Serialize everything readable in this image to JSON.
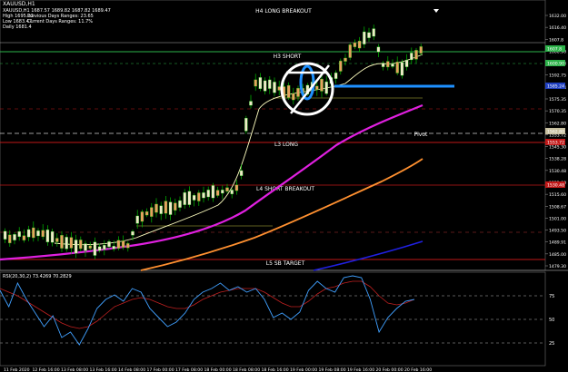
{
  "window": {
    "title": "XAUUSD,H1"
  },
  "ohlc_header": "XAUUSD,H1  1687.57 1689.82 1687.82 1689.47",
  "info_lines": [
    {
      "left": "High 1695.12",
      "right": "Previous Days Ranges: 23.65"
    },
    {
      "left": "Low 1683.47",
      "right": "Current Days Ranges: 11.7%"
    },
    {
      "left": "Daily 1681.4",
      "right": ""
    }
  ],
  "levels": {
    "h4": "H4 LONG BREAKOUT",
    "h3": "H3 SHORT",
    "l3": "L3 LONG",
    "l4": "L4 SHORT BREAKOUT",
    "l5": "L5 SB TARGET",
    "pivot": "Pivot"
  },
  "price_scale": [
    "1632.00",
    "1616.40",
    "1607.8",
    "1600.90",
    "1600.73",
    "1592.75",
    "1585.24",
    "1575.35",
    "1570.35",
    "1562.80",
    "1553.72",
    "1545.30",
    "1538.28",
    "1530.48",
    "1522.80",
    "1515.60",
    "1508.67",
    "1501.00",
    "1493.50",
    "1489.91",
    "1485.00",
    "1479.30"
  ],
  "price_scale_tags": [
    {
      "label": "1607.8",
      "color": "#2db34a"
    },
    {
      "label": "1600.90",
      "color": "#2db34a"
    },
    {
      "label": "1585.24",
      "color": "#2040c0"
    },
    {
      "label": "1562.80",
      "color": "#c8c0a0"
    },
    {
      "label": "1553.72",
      "color": "#c01818"
    },
    {
      "label": "1530.48",
      "color": "#c01818"
    }
  ],
  "indicator": {
    "label": "RSI(20,30,2) 73.4269 70.2829",
    "scale": [
      "75",
      "50",
      "25"
    ]
  },
  "time_axis": [
    "11 Feb 2020",
    "12 Feb 16:00",
    "13 Feb 08:00",
    "13 Feb 16:00",
    "14 Feb 08:00",
    "17 Feb 00:00",
    "17 Feb 08:00",
    "18 Feb 00:00",
    "18 Feb 08:00",
    "18 Feb 16:00",
    "19 Feb 00:00",
    "19 Feb 08:00",
    "19 Feb 16:00",
    "20 Feb 00:00",
    "20 Feb 16:00"
  ],
  "colors": {
    "background": "#000000",
    "bull_candle": "#f0e8c8",
    "bear_candle": "#e8a060",
    "wick": "#00c000",
    "ma_fast": "#ffffc0",
    "ma_magenta": "#e020e0",
    "ma_orange": "#ff9030",
    "ma_blue": "#2020e0",
    "level_red": "#c01818",
    "level_green": "#2db34a",
    "annotation_blue": "#1e90ff",
    "rsi_main": "#40a0ff",
    "rsi_signal": "#c02020"
  }
}
